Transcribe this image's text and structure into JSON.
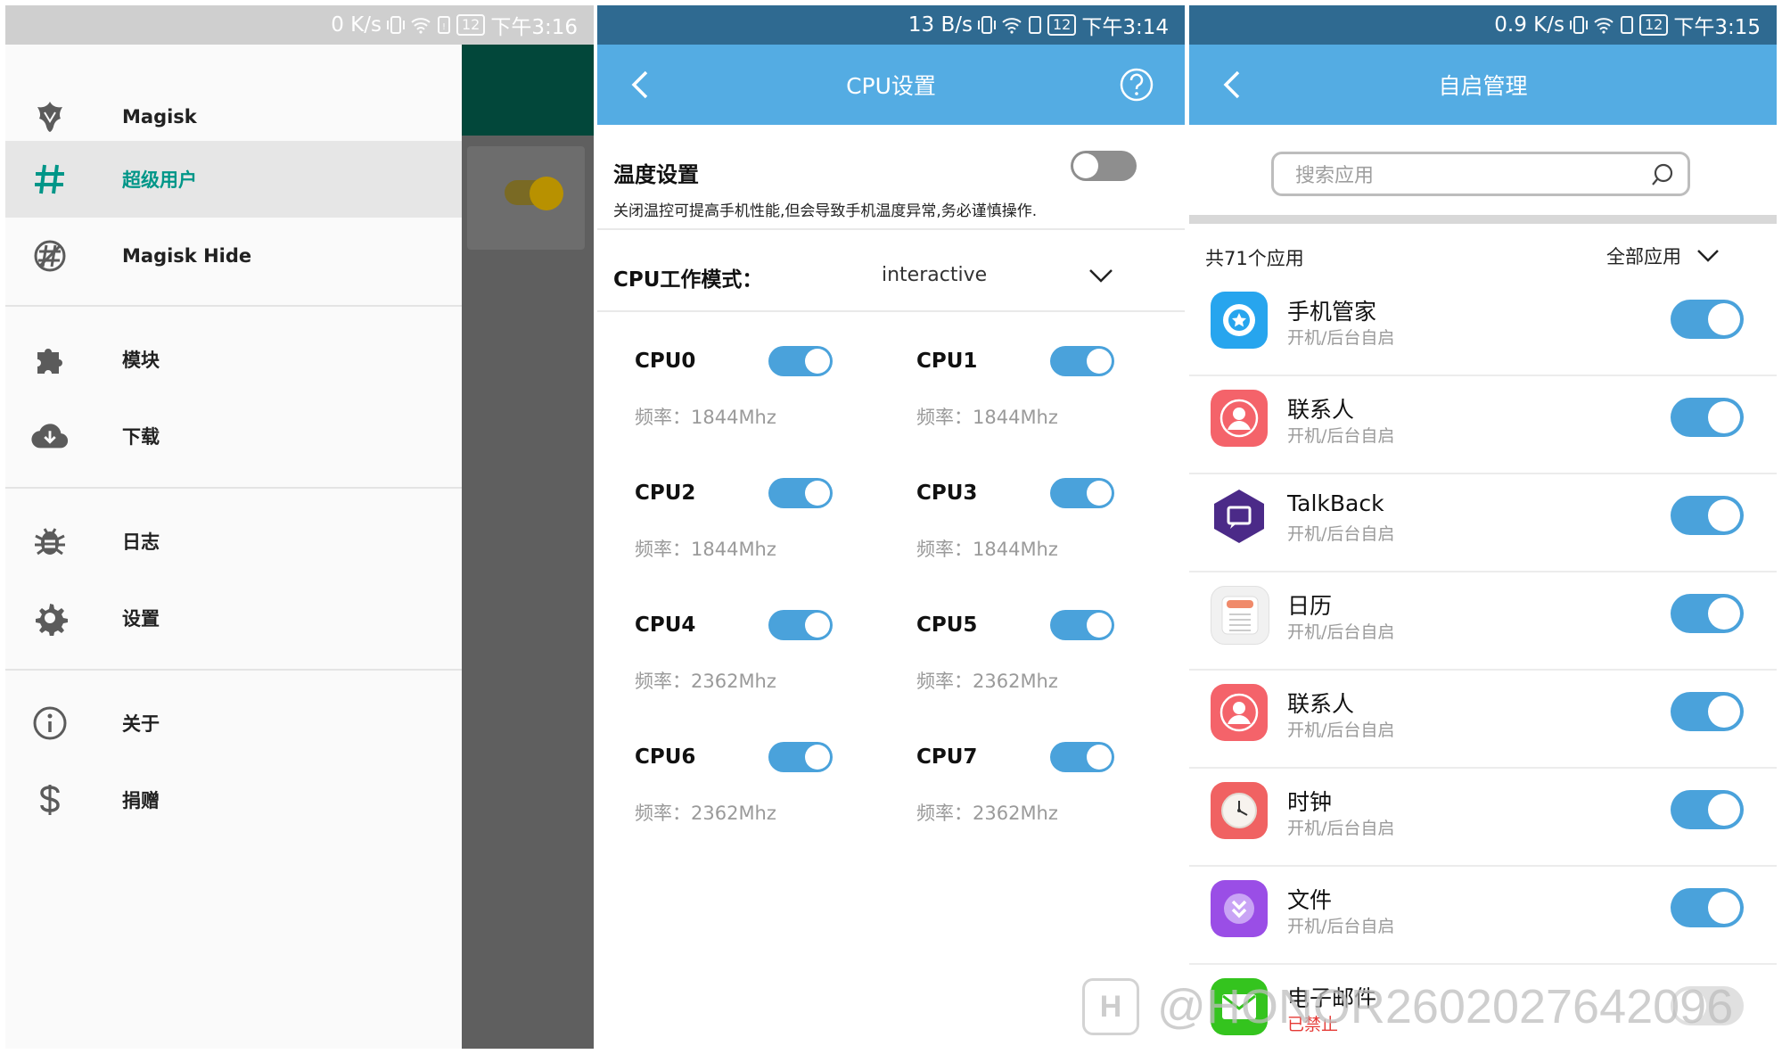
{
  "panel1": {
    "status": {
      "speed": "0 K/s",
      "battery": "12",
      "time": "下午3:16"
    },
    "nav": {
      "items": [
        {
          "label": "Magisk",
          "icon": "magisk-logo-icon"
        },
        {
          "label": "超级用户",
          "icon": "hash-icon",
          "active": true
        },
        {
          "label": "Magisk Hide",
          "icon": "magisk-hide-icon"
        },
        {
          "label": "模块",
          "icon": "puzzle-icon"
        },
        {
          "label": "下载",
          "icon": "cloud-download-icon"
        },
        {
          "label": "日志",
          "icon": "bug-icon"
        },
        {
          "label": "设置",
          "icon": "gear-icon"
        },
        {
          "label": "关于",
          "icon": "info-icon"
        },
        {
          "label": "捐赠",
          "icon": "dollar-icon"
        }
      ]
    }
  },
  "panel2": {
    "status": {
      "speed": "13 B/s",
      "battery": "12",
      "time": "下午3:14"
    },
    "title": "CPU设置",
    "temperature": {
      "title": "温度设置",
      "description": "关闭温控可提高手机性能,但会导致手机温度异常,务必谨慎操作.",
      "enabled": false
    },
    "mode": {
      "label": "CPU工作模式：",
      "value": "interactive"
    },
    "cpus": [
      {
        "name": "CPU0",
        "freq": "频率：1844Mhz",
        "enabled": true
      },
      {
        "name": "CPU1",
        "freq": "频率：1844Mhz",
        "enabled": true
      },
      {
        "name": "CPU2",
        "freq": "频率：1844Mhz",
        "enabled": true
      },
      {
        "name": "CPU3",
        "freq": "频率：1844Mhz",
        "enabled": true
      },
      {
        "name": "CPU4",
        "freq": "频率：2362Mhz",
        "enabled": true
      },
      {
        "name": "CPU5",
        "freq": "频率：2362Mhz",
        "enabled": true
      },
      {
        "name": "CPU6",
        "freq": "频率：2362Mhz",
        "enabled": true
      },
      {
        "name": "CPU7",
        "freq": "频率：2362Mhz",
        "enabled": true
      }
    ]
  },
  "panel3": {
    "status": {
      "speed": "0.9 K/s",
      "battery": "12",
      "time": "下午3:15"
    },
    "title": "自启管理",
    "search": {
      "placeholder": "搜索应用"
    },
    "count_label": "共71个应用",
    "filter_label": "全部应用",
    "apps": [
      {
        "name": "手机管家",
        "sub": "开机/后台自启",
        "icon": "phone-manager-icon",
        "color": "#27a5ee",
        "enabled": true
      },
      {
        "name": "联系人",
        "sub": "开机/后台自启",
        "icon": "contacts-icon",
        "color": "#f4636a",
        "enabled": true
      },
      {
        "name": "TalkBack",
        "sub": "开机/后台自启",
        "icon": "talkback-icon",
        "color": "#4b2a88",
        "enabled": true
      },
      {
        "name": "日历",
        "sub": "开机/后台自启",
        "icon": "calendar-icon",
        "color": "#eeeeee",
        "enabled": true
      },
      {
        "name": "联系人",
        "sub": "开机/后台自启",
        "icon": "contacts-icon",
        "color": "#f4636a",
        "enabled": true
      },
      {
        "name": "时钟",
        "sub": "开机/后台自启",
        "icon": "clock-icon",
        "color": "#f06262",
        "enabled": true
      },
      {
        "name": "文件",
        "sub": "开机/后台自启",
        "icon": "files-icon",
        "color": "#9a4ee6",
        "enabled": true
      },
      {
        "name": "电子邮件",
        "sub": "已禁止",
        "icon": "email-icon",
        "color": "#34c41e",
        "enabled": false
      }
    ]
  },
  "watermark": {
    "text": "@HONOR2602027642096",
    "logo": "H"
  },
  "colors": {
    "blue_bar": "#54ace3",
    "toggle_on": "#4aa2db",
    "magisk_active": "#009688"
  }
}
